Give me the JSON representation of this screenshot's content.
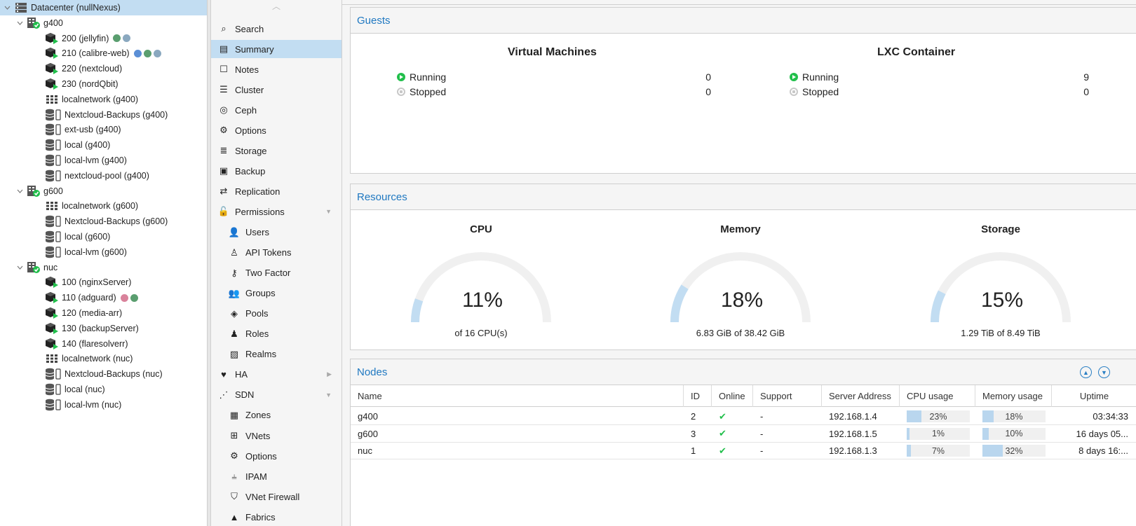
{
  "tree": {
    "items": [
      {
        "label": "Datacenter (nullNexus)",
        "type": "datacenter",
        "level": 0,
        "expanded": true,
        "selected": true,
        "dots": []
      },
      {
        "label": "g400",
        "type": "node",
        "level": 1,
        "expanded": true,
        "dots": []
      },
      {
        "label": "200 (jellyfin)",
        "type": "lxc",
        "level": 2,
        "dots": [
          "#5a9e6f",
          "#8aa8bf"
        ]
      },
      {
        "label": "210 (calibre-web)",
        "type": "lxc",
        "level": 2,
        "dots": [
          "#5b8fd6",
          "#5a9e6f",
          "#8aa8bf"
        ]
      },
      {
        "label": "220 (nextcloud)",
        "type": "lxc",
        "level": 2,
        "dots": []
      },
      {
        "label": "230 (nordQbit)",
        "type": "lxc",
        "level": 2,
        "dots": []
      },
      {
        "label": "localnetwork (g400)",
        "type": "network",
        "level": 2,
        "dots": []
      },
      {
        "label": "Nextcloud-Backups (g400)",
        "type": "storage",
        "level": 2,
        "dots": []
      },
      {
        "label": "ext-usb (g400)",
        "type": "storage",
        "level": 2,
        "dots": []
      },
      {
        "label": "local (g400)",
        "type": "storage",
        "level": 2,
        "dots": []
      },
      {
        "label": "local-lvm (g400)",
        "type": "storage",
        "level": 2,
        "dots": []
      },
      {
        "label": "nextcloud-pool (g400)",
        "type": "storage",
        "level": 2,
        "dots": []
      },
      {
        "label": "g600",
        "type": "node",
        "level": 1,
        "expanded": true,
        "dots": []
      },
      {
        "label": "localnetwork (g600)",
        "type": "network",
        "level": 2,
        "dots": []
      },
      {
        "label": "Nextcloud-Backups (g600)",
        "type": "storage",
        "level": 2,
        "dots": []
      },
      {
        "label": "local (g600)",
        "type": "storage",
        "level": 2,
        "dots": []
      },
      {
        "label": "local-lvm (g600)",
        "type": "storage",
        "level": 2,
        "dots": []
      },
      {
        "label": "nuc",
        "type": "node",
        "level": 1,
        "expanded": true,
        "dots": []
      },
      {
        "label": "100 (nginxServer)",
        "type": "lxc",
        "level": 2,
        "dots": []
      },
      {
        "label": "110 (adguard)",
        "type": "lxc",
        "level": 2,
        "dots": [
          "#d9829b",
          "#5a9e6f"
        ]
      },
      {
        "label": "120 (media-arr)",
        "type": "lxc",
        "level": 2,
        "dots": []
      },
      {
        "label": "130 (backupServer)",
        "type": "lxc",
        "level": 2,
        "dots": []
      },
      {
        "label": "140 (flaresolverr)",
        "type": "lxc",
        "level": 2,
        "dots": []
      },
      {
        "label": "localnetwork (nuc)",
        "type": "network",
        "level": 2,
        "dots": []
      },
      {
        "label": "Nextcloud-Backups (nuc)",
        "type": "storage",
        "level": 2,
        "dots": []
      },
      {
        "label": "local (nuc)",
        "type": "storage",
        "level": 2,
        "dots": []
      },
      {
        "label": "local-lvm (nuc)",
        "type": "storage",
        "level": 2,
        "dots": []
      }
    ]
  },
  "menu": {
    "items": [
      {
        "label": "Search",
        "icon": "search-icon",
        "glyph": "⌕",
        "indent": 0
      },
      {
        "label": "Summary",
        "icon": "book-icon",
        "glyph": "▤",
        "indent": 0,
        "selected": true
      },
      {
        "label": "Notes",
        "icon": "note-icon",
        "glyph": "☐",
        "indent": 0
      },
      {
        "label": "Cluster",
        "icon": "server-icon",
        "glyph": "☰",
        "indent": 0
      },
      {
        "label": "Ceph",
        "icon": "ceph-icon",
        "glyph": "◎",
        "indent": 0
      },
      {
        "label": "Options",
        "icon": "gear-icon",
        "glyph": "⚙",
        "indent": 0
      },
      {
        "label": "Storage",
        "icon": "database-icon",
        "glyph": "≣",
        "indent": 0
      },
      {
        "label": "Backup",
        "icon": "floppy-icon",
        "glyph": "▣",
        "indent": 0
      },
      {
        "label": "Replication",
        "icon": "retweet-icon",
        "glyph": "⇄",
        "indent": 0
      },
      {
        "label": "Permissions",
        "icon": "unlock-icon",
        "glyph": "🔓",
        "indent": 0,
        "arrow": "▼"
      },
      {
        "label": "Users",
        "icon": "user-icon",
        "glyph": "👤",
        "indent": 1
      },
      {
        "label": "API Tokens",
        "icon": "user-outline-icon",
        "glyph": "♙",
        "indent": 1
      },
      {
        "label": "Two Factor",
        "icon": "key-icon",
        "glyph": "⚷",
        "indent": 1
      },
      {
        "label": "Groups",
        "icon": "users-icon",
        "glyph": "👥",
        "indent": 1
      },
      {
        "label": "Pools",
        "icon": "tags-icon",
        "glyph": "◈",
        "indent": 1
      },
      {
        "label": "Roles",
        "icon": "male-icon",
        "glyph": "♟",
        "indent": 1
      },
      {
        "label": "Realms",
        "icon": "address-book-icon",
        "glyph": "▨",
        "indent": 1
      },
      {
        "label": "HA",
        "icon": "heartbeat-icon",
        "glyph": "♥",
        "indent": 0,
        "arrow": "▶"
      },
      {
        "label": "SDN",
        "icon": "sdn-icon",
        "glyph": "⋰",
        "indent": 0,
        "arrow": "▼"
      },
      {
        "label": "Zones",
        "icon": "grid-icon",
        "glyph": "▦",
        "indent": 1
      },
      {
        "label": "VNets",
        "icon": "sitemap-icon",
        "glyph": "⊞",
        "indent": 1
      },
      {
        "label": "Options",
        "icon": "gear-icon",
        "glyph": "⚙",
        "indent": 1
      },
      {
        "label": "IPAM",
        "icon": "ipam-icon",
        "glyph": "⫨",
        "indent": 1
      },
      {
        "label": "VNet Firewall",
        "icon": "shield-icon",
        "glyph": "⛉",
        "indent": 1
      },
      {
        "label": "Fabrics",
        "icon": "road-icon",
        "glyph": "▲",
        "indent": 1
      }
    ]
  },
  "guests": {
    "title": "Guests",
    "vm": {
      "title": "Virtual Machines",
      "running_label": "Running",
      "running": "0",
      "stopped_label": "Stopped",
      "stopped": "0"
    },
    "lxc": {
      "title": "LXC Container",
      "running_label": "Running",
      "running": "9",
      "stopped_label": "Stopped",
      "stopped": "0"
    }
  },
  "resources": {
    "title": "Resources",
    "gauges": [
      {
        "title": "CPU",
        "percent": 11,
        "value": "11%",
        "sub": "of 16 CPU(s)"
      },
      {
        "title": "Memory",
        "percent": 18,
        "value": "18%",
        "sub": "6.83 GiB of 38.42 GiB"
      },
      {
        "title": "Storage",
        "percent": 15,
        "value": "15%",
        "sub": "1.29 TiB of 8.49 TiB"
      }
    ]
  },
  "nodes": {
    "title": "Nodes",
    "columns": [
      "Name",
      "ID",
      "Online",
      "Support",
      "Server Address",
      "CPU usage",
      "Memory usage",
      "Uptime"
    ],
    "rows": [
      {
        "name": "g400",
        "id": "2",
        "online": "✔",
        "support": "-",
        "address": "192.168.1.4",
        "cpu": 23,
        "cpu_text": "23%",
        "mem": 18,
        "mem_text": "18%",
        "uptime": "03:34:33"
      },
      {
        "name": "g600",
        "id": "3",
        "online": "✔",
        "support": "-",
        "address": "192.168.1.5",
        "cpu": 1,
        "cpu_text": "1%",
        "mem": 10,
        "mem_text": "10%",
        "uptime": "16 days 05..."
      },
      {
        "name": "nuc",
        "id": "1",
        "online": "✔",
        "support": "-",
        "address": "192.168.1.3",
        "cpu": 7,
        "cpu_text": "7%",
        "mem": 32,
        "mem_text": "32%",
        "uptime": "8 days 16:..."
      }
    ]
  },
  "colors": {
    "accent": "#1f78c1",
    "selected": "#c2ddf2",
    "running": "#21bf4b",
    "bar": "#b9d6ee"
  }
}
